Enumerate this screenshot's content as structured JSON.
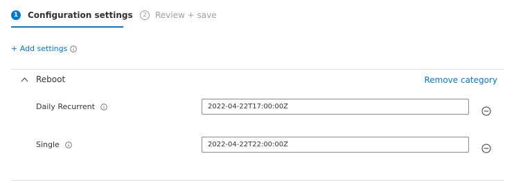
{
  "tabs": [
    {
      "number": "1",
      "label": "Configuration settings"
    },
    {
      "number": "2",
      "label": "Review + save"
    }
  ],
  "add_settings": {
    "label": "+ Add settings"
  },
  "category": {
    "title": "Reboot",
    "remove_label": "Remove category",
    "settings": [
      {
        "label": "Daily Recurrent",
        "value": "2022-04-22T17:00:00Z"
      },
      {
        "label": "Single",
        "value": "2022-04-22T22:00:00Z"
      }
    ]
  },
  "colors": {
    "accent": "#0078d4",
    "border": "#8a8886",
    "muted": "#a19f9d"
  },
  "icons": {
    "info": "info-icon",
    "chevron": "chevron-up-icon",
    "remove": "remove-circle-icon"
  }
}
